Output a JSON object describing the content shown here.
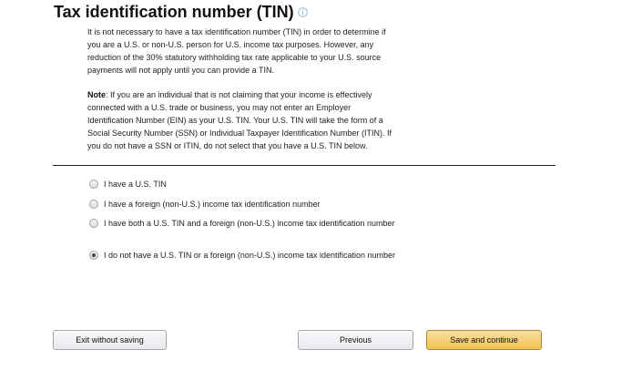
{
  "section": {
    "title": "Tax identification number (TIN)",
    "info_icon": "info-circle-icon",
    "description": "It is not necessary to have a tax identification number (TIN) in order to determine if you are a U.S. or non-U.S. person for U.S. income tax purposes. However, any reduction of the 30% statutory withholding tax rate applicable to your U.S. source payments will not apply until you can provide a TIN.",
    "note_label": "Note",
    "note_text": ": If you are an individual that is not claiming that your income is effectively connected with a U.S. trade or business, you may not enter an Employer Identification Number (EIN) as your U.S. TIN. Your U.S. TIN will take the form of a Social Security Number (SSN) or Individual Taxpayer Identification Number (ITIN). If you do not have a SSN or ITIN, do not select that you have a U.S. TIN below."
  },
  "options": [
    {
      "label": "I have a U.S. TIN",
      "checked": false
    },
    {
      "label": "I have a foreign (non-U.S.) income tax identification number",
      "checked": false
    },
    {
      "label": "I have both a U.S. TIN and a foreign (non-U.S.) income tax identification number",
      "checked": false
    },
    {
      "label": "I do not have a U.S. TIN or a foreign (non-U.S.) income tax identification number",
      "checked": true
    }
  ],
  "buttons": {
    "exit": "Exit without saving",
    "previous": "Previous",
    "save": "Save and continue"
  },
  "colors": {
    "primary_button": "#f0c14b",
    "primary_border": "#a88734",
    "info_icon": "#8fbcd8"
  }
}
